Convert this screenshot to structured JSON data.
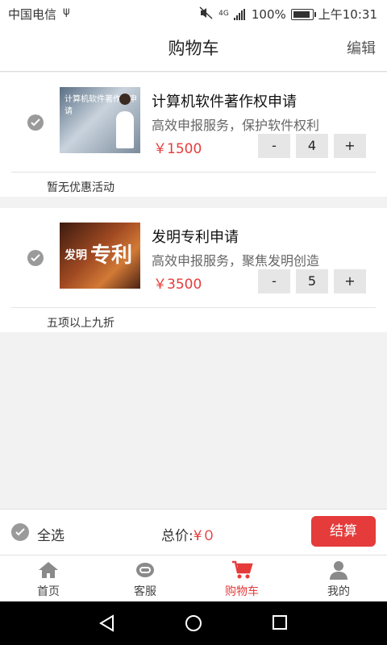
{
  "status": {
    "carrier": "中国电信",
    "usb_icon": "usb-icon",
    "network": "4G",
    "battery": "100%",
    "time": "上午10:31"
  },
  "header": {
    "title": "购物车",
    "edit": "编辑"
  },
  "items": [
    {
      "name": "计算机软件著作权申请",
      "desc": "高效申报服务，保护软件权利",
      "price": "￥1500",
      "minus": "-",
      "qty": "4",
      "plus": "+",
      "promo": "暂无优惠活动",
      "thumb_text": "计算机软件著作权申请"
    },
    {
      "name": "发明专利申请",
      "desc": "高效申报服务，聚焦发明创造",
      "price": "￥3500",
      "minus": "-",
      "qty": "5",
      "plus": "+",
      "promo": "五项以上九折",
      "thumb_text_a": "发明",
      "thumb_text_b": "专利"
    }
  ],
  "bottom": {
    "select_all": "全选",
    "total_label": "总价:",
    "total_value": "¥０",
    "checkout": "结算"
  },
  "tabs": [
    {
      "label": "首页",
      "icon": "home-icon"
    },
    {
      "label": "客服",
      "icon": "headset-icon"
    },
    {
      "label": "购物车",
      "icon": "cart-icon"
    },
    {
      "label": "我的",
      "icon": "user-icon"
    }
  ],
  "colors": {
    "accent": "#e53b3b",
    "price": "#e63c3c"
  }
}
